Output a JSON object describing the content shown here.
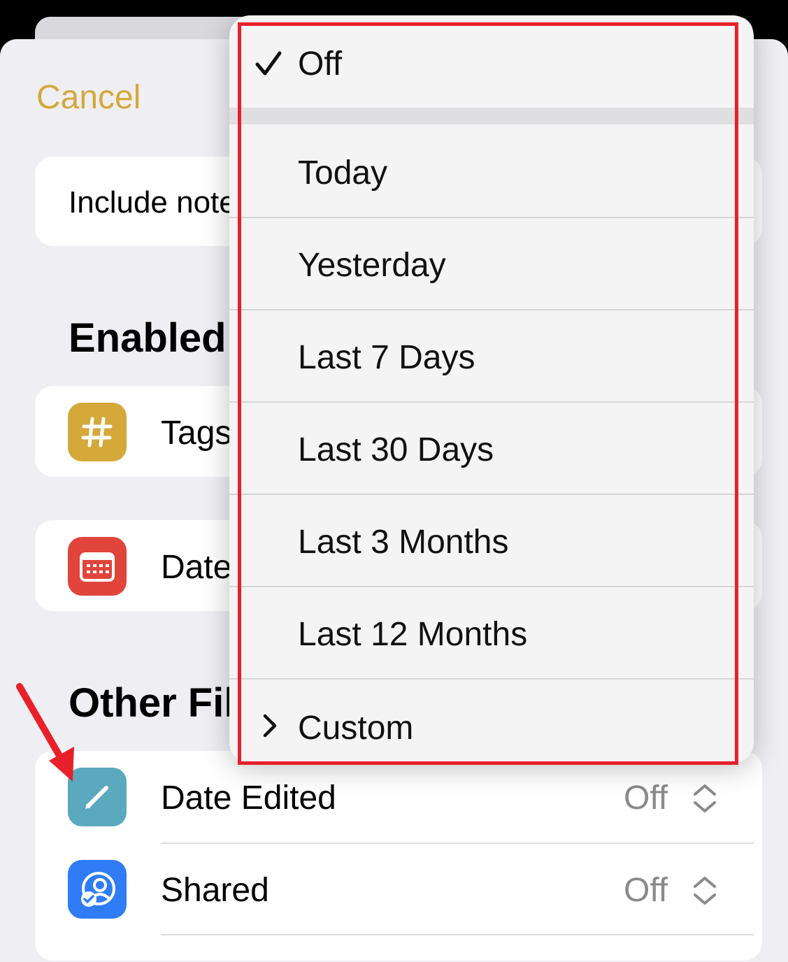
{
  "header": {
    "cancel_label": "Cancel"
  },
  "include_row": {
    "label": "Include note"
  },
  "enabled_section": {
    "title": "Enabled",
    "items": [
      {
        "label": "Tags",
        "icon": "hashtag-icon",
        "color": "#d4a93a"
      },
      {
        "label": "Date",
        "icon": "calendar-icon",
        "color": "#e0443a"
      }
    ]
  },
  "other_section": {
    "title": "Other Fil",
    "items": [
      {
        "label": "Date Edited",
        "value": "Off",
        "icon": "pencil-icon",
        "color": "#5aa9bf"
      },
      {
        "label": "Shared",
        "value": "Off",
        "icon": "shared-person-icon",
        "color": "#2f7cf6"
      }
    ]
  },
  "menu": {
    "selected": "Off",
    "items": [
      {
        "label": "Off"
      },
      {
        "label": "Today"
      },
      {
        "label": "Yesterday"
      },
      {
        "label": "Last 7 Days"
      },
      {
        "label": "Last 30 Days"
      },
      {
        "label": "Last 3 Months"
      },
      {
        "label": "Last 12 Months"
      },
      {
        "label": "Custom"
      }
    ]
  },
  "annotations": {
    "highlight_color": "#e8202a",
    "arrow_color": "#e8202a"
  }
}
